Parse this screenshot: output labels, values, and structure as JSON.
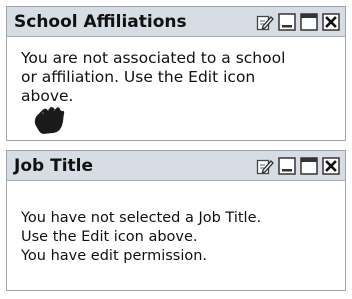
{
  "portlets": [
    {
      "title": "School Affiliations",
      "lines": [
        "You are not associated to a school",
        "or affiliation. Use the Edit icon",
        "above."
      ]
    },
    {
      "title": "Job Title",
      "lines": [
        "You have not selected a Job Title.",
        "Use the Edit icon above.",
        "You have edit permission."
      ]
    }
  ],
  "icons": [
    "edit-icon",
    "minimize-icon",
    "maximize-icon",
    "close-icon"
  ],
  "colors": {
    "titlebar": "#d7dde4",
    "border": "#9aa3ae"
  }
}
